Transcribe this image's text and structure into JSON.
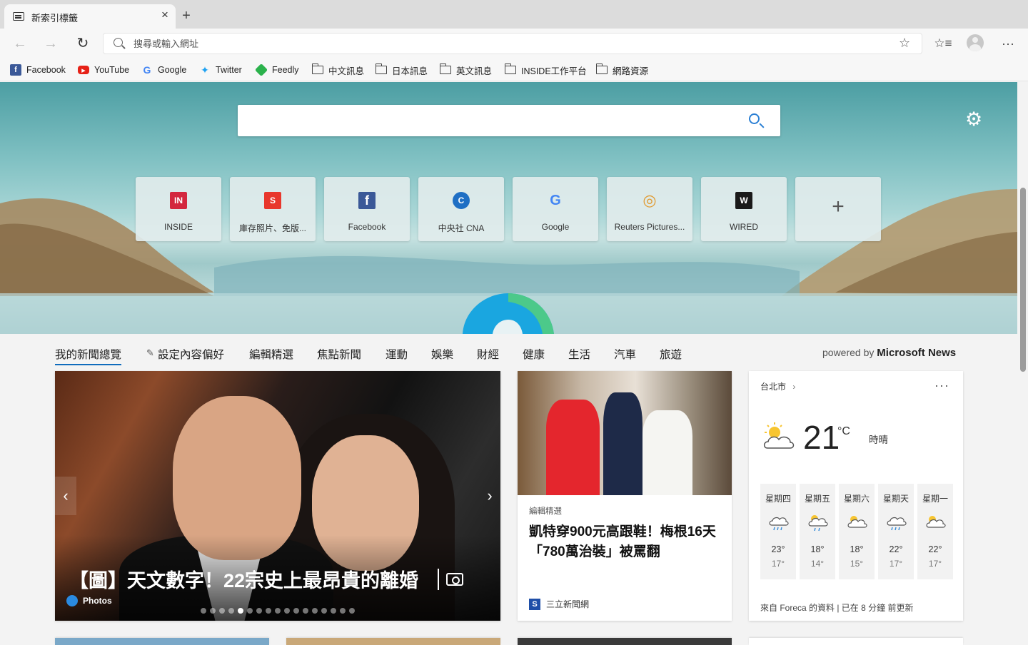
{
  "tab": {
    "title": "新索引標籤",
    "close": "×",
    "new": "+"
  },
  "toolbar": {
    "back": "←",
    "forward": "→",
    "reload": "↻",
    "address_placeholder": "搜尋或輸入網址",
    "address_value": ""
  },
  "bookmarks": [
    {
      "label": "Facebook",
      "icon": "facebook-icon"
    },
    {
      "label": "YouTube",
      "icon": "youtube-icon"
    },
    {
      "label": "Google",
      "icon": "google-icon"
    },
    {
      "label": "Twitter",
      "icon": "twitter-icon"
    },
    {
      "label": "Feedly",
      "icon": "feedly-icon"
    },
    {
      "label": "中文訊息",
      "icon": "folder-icon"
    },
    {
      "label": "日本訊息",
      "icon": "folder-icon"
    },
    {
      "label": "英文訊息",
      "icon": "folder-icon"
    },
    {
      "label": "INSIDE工作平台",
      "icon": "folder-icon"
    },
    {
      "label": "網路資源",
      "icon": "folder-icon"
    }
  ],
  "hero": {
    "search_placeholder": ""
  },
  "quick_links": [
    {
      "label": "INSIDE",
      "glyph": "IN",
      "color": "#d3273e"
    },
    {
      "label": "庫存照片、免版...",
      "glyph": "S",
      "color": "#e8372c"
    },
    {
      "label": "Facebook",
      "glyph": "f",
      "color": "#3b5998"
    },
    {
      "label": "中央社 CNA",
      "glyph": "C",
      "color": "#1f6fc4"
    },
    {
      "label": "Google",
      "glyph": "G",
      "color": "#ffffff"
    },
    {
      "label": "Reuters Pictures...",
      "glyph": "◎",
      "color": "#f0b44c"
    },
    {
      "label": "WIRED",
      "glyph": "W",
      "color": "#1a1a1a"
    },
    {
      "label": "",
      "glyph": "+",
      "color": ""
    }
  ],
  "news_nav": {
    "items": [
      "我的新聞總覽",
      "設定內容偏好",
      "編輯精選",
      "焦點新聞",
      "運動",
      "娛樂",
      "財經",
      "健康",
      "生活",
      "汽車",
      "旅遊"
    ],
    "pencil": "✎",
    "powered_prefix": "powered by",
    "powered_brand": "Microsoft News"
  },
  "card_main": {
    "headline": "【圖】天文數字！22宗史上最昂貴的離婚",
    "source": "Photos",
    "prev": "‹",
    "next": "›",
    "slide_count": 17,
    "active_slide": 5
  },
  "card_second": {
    "kicker": "編輯精選",
    "title": "凱特穿900元高跟鞋！梅根16天「780萬治裝」被罵翻",
    "source": "三立新聞網",
    "source_logo": "S"
  },
  "weather": {
    "city": "台北市",
    "chevron": "›",
    "more": "···",
    "temp": "21",
    "unit": "°C",
    "condition": "時晴",
    "forecast": [
      {
        "day": "星期四",
        "hi": "23°",
        "lo": "17°",
        "icon": "rain-cloud-icon"
      },
      {
        "day": "星期五",
        "hi": "18°",
        "lo": "14°",
        "icon": "sun-rain-icon"
      },
      {
        "day": "星期六",
        "hi": "18°",
        "lo": "15°",
        "icon": "partly-sunny-icon"
      },
      {
        "day": "星期天",
        "hi": "22°",
        "lo": "17°",
        "icon": "rain-cloud-icon"
      },
      {
        "day": "星期一",
        "hi": "22°",
        "lo": "17°",
        "icon": "partly-sunny-icon"
      }
    ],
    "footer": "來自 Foreca 的資料 | 已在 8 分鐘 前更新"
  }
}
